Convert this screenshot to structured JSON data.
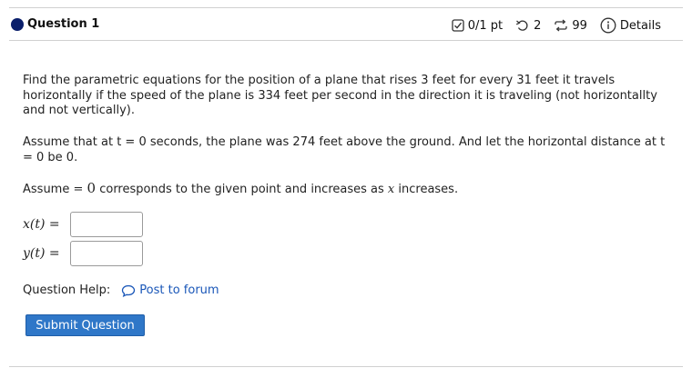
{
  "question": {
    "title": "Question 1",
    "score": "0/1 pt",
    "retries": "2",
    "attempts": "99",
    "details_label": "Details"
  },
  "body": {
    "paragraph1": "Find the parametric equations for the position of a plane that rises 3 feet for every 31 feet it travels horizontally if the speed of the plane is 334 feet per second in the direction it is traveling (not horizontallty and not vertically).",
    "paragraph2": "Assume that at t = 0 seconds, the plane was 274 feet above the ground. And let the horizontal distance at t = 0 be 0.",
    "assume_prefix": "Assume",
    "assume_eq": "=",
    "assume_zero": "0",
    "assume_mid": "corresponds to the given point and  increases as",
    "assume_var": "x",
    "assume_suffix": "increases."
  },
  "answers": [
    {
      "label": "x(t) =",
      "value": ""
    },
    {
      "label": "y(t) =",
      "value": ""
    }
  ],
  "help": {
    "label": "Question Help:",
    "link": "Post to forum"
  },
  "submit_label": "Submit Question",
  "colors": {
    "accent": "#2f77c8",
    "link": "#1a57b8",
    "status_dot": "#0a1f6b"
  }
}
